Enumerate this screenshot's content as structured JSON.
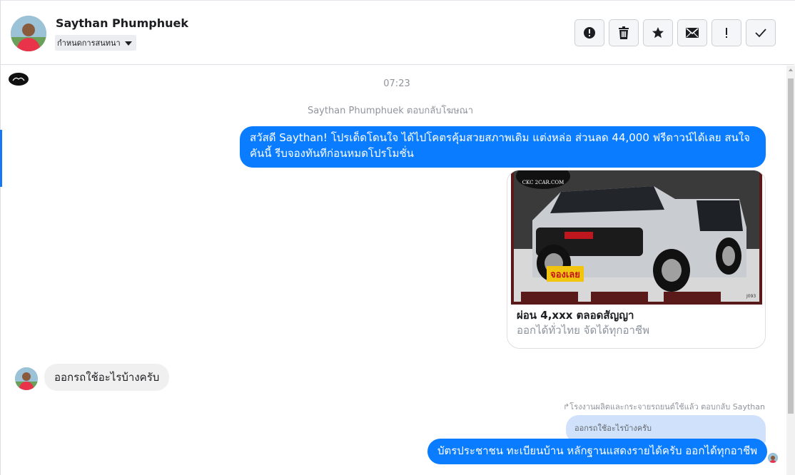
{
  "header": {
    "contact_name": "Saythan Phumphuek",
    "assign_label": "กำหนดการสนทนา",
    "actions": [
      {
        "icon": "alert-circle-icon",
        "label": "Mark as spam"
      },
      {
        "icon": "trash-icon",
        "label": "Delete"
      },
      {
        "icon": "star-icon",
        "label": "Star"
      },
      {
        "icon": "envelope-icon",
        "label": "Mark as unread"
      },
      {
        "icon": "exclamation-icon",
        "label": "Follow up"
      },
      {
        "icon": "checkmark-icon",
        "label": "Mark as done"
      }
    ]
  },
  "conversation": {
    "timestamp": "07:23",
    "ad_reply_meta": "Saythan Phumphuek ตอบกลับโฆษณา",
    "outgoing_1": "สวัสดี Saythan! โปรเด็ดโดนใจ ได้ไปโคตรคุ้มสวยสภาพเดิม แต่งหล่อ  ส่วนลด 44,000 ฟรีดาวน์ได้เลย  สนใจคันนี้ รีบจองทันทีก่อนหมดโปรโมชั่น",
    "ad_card": {
      "title": "ผ่อน 4,xxx ตลอดสัญญา",
      "subtitle": "ออกได้ทั่วไทย จัดได้ทุกอาชีพ",
      "image_watermark": "CKC 2CAR.COM",
      "image_stamp": "จองเลย",
      "image_code": "J093"
    },
    "incoming_1": "ออกรถใช้อะไรบ้างครับ",
    "reply_meta": "โรงงานผลิตและกระจายรถยนต์ใช้แล้ว ตอบกลับ Saythan",
    "reply_quote": "ออกรถใช้อะไรบ้างครับ",
    "outgoing_2": "บัตรประชาชน ทะเบียนบ้าน หลักฐานแสดงรายได้ครับ ออกได้ทุกอาชีพ"
  },
  "colors": {
    "outgoing_bubble": "#0a7cff",
    "incoming_bubble": "#f1f0f0",
    "quote_bubble": "#cfe1fb",
    "accent": "#1877f2"
  }
}
